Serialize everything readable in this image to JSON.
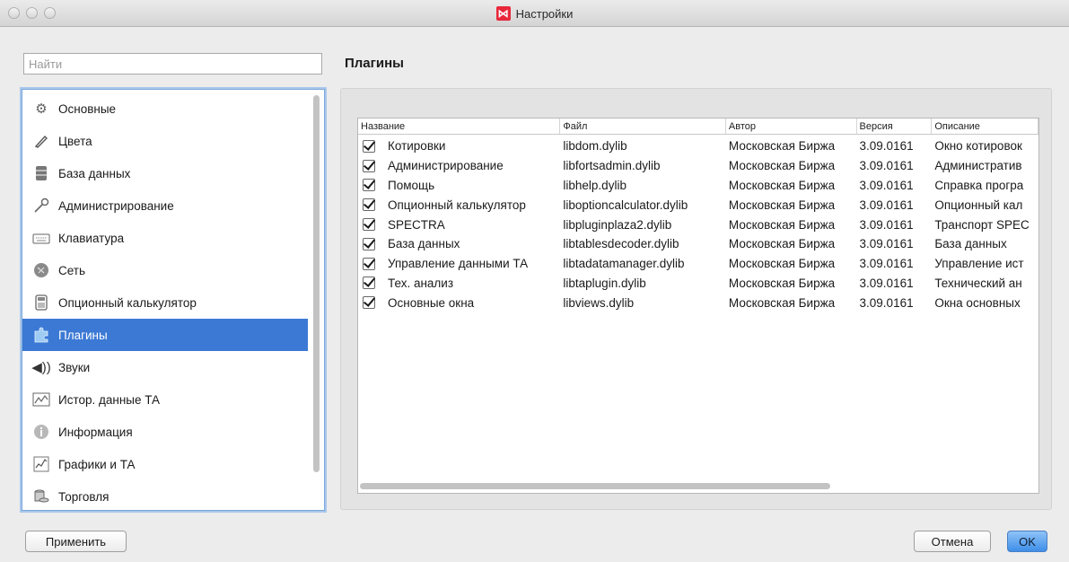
{
  "window": {
    "title": "Настройки"
  },
  "search": {
    "placeholder": "Найти",
    "value": ""
  },
  "sidebar": {
    "items": [
      {
        "label": "Основные",
        "icon": "gear-icon"
      },
      {
        "label": "Цвета",
        "icon": "brush-icon"
      },
      {
        "label": "База данных",
        "icon": "database-icon"
      },
      {
        "label": "Администрирование",
        "icon": "key-icon"
      },
      {
        "label": "Клавиатура",
        "icon": "keyboard-icon"
      },
      {
        "label": "Сеть",
        "icon": "network-icon"
      },
      {
        "label": "Опционный калькулятор",
        "icon": "calculator-icon"
      },
      {
        "label": "Плагины",
        "icon": "puzzle-icon",
        "active": true
      },
      {
        "label": "Звуки",
        "icon": "speaker-icon"
      },
      {
        "label": "Истор. данные ТА",
        "icon": "history-chart-icon"
      },
      {
        "label": "Информация",
        "icon": "info-icon"
      },
      {
        "label": "Графики и ТА",
        "icon": "line-chart-icon"
      },
      {
        "label": "Торговля",
        "icon": "coins-icon"
      }
    ]
  },
  "main": {
    "title": "Плагины",
    "table": {
      "columns": [
        "Название",
        "Файл",
        "Автор",
        "Версия",
        "Описание"
      ],
      "rows": [
        {
          "checked": true,
          "name": "Котировки",
          "file": "libdom.dylib",
          "author": "Московская Биржа",
          "version": "3.09.0161",
          "description": "Окно котировок"
        },
        {
          "checked": true,
          "name": "Администрирование",
          "file": "libfortsadmin.dylib",
          "author": "Московская Биржа",
          "version": "3.09.0161",
          "description": "Административ"
        },
        {
          "checked": true,
          "name": "Помощь",
          "file": "libhelp.dylib",
          "author": "Московская Биржа",
          "version": "3.09.0161",
          "description": "Справка програ"
        },
        {
          "checked": true,
          "name": "Опционный калькулятор",
          "file": "liboptioncalculator.dylib",
          "author": "Московская Биржа",
          "version": "3.09.0161",
          "description": "Опционный кал"
        },
        {
          "checked": true,
          "name": "SPECTRA",
          "file": "libpluginplaza2.dylib",
          "author": "Московская Биржа",
          "version": "3.09.0161",
          "description": "Транспорт SPEC"
        },
        {
          "checked": true,
          "name": "База данных",
          "file": "libtablesdecoder.dylib",
          "author": "Московская Биржа",
          "version": "3.09.0161",
          "description": "База данных"
        },
        {
          "checked": true,
          "name": "Управление данными ТА",
          "file": "libtadatamanager.dylib",
          "author": "Московская Биржа",
          "version": "3.09.0161",
          "description": "Управление ист"
        },
        {
          "checked": true,
          "name": "Тех. анализ",
          "file": "libtaplugin.dylib",
          "author": "Московская Биржа",
          "version": "3.09.0161",
          "description": "Технический ан"
        },
        {
          "checked": true,
          "name": "Основные окна",
          "file": "libviews.dylib",
          "author": "Московская Биржа",
          "version": "3.09.0161",
          "description": "Окна основных"
        }
      ]
    }
  },
  "buttons": {
    "apply": "Применить",
    "cancel": "Отмена",
    "ok": "OK"
  },
  "colors": {
    "selection": "#3b79d4",
    "app_logo": "#e8273a"
  }
}
